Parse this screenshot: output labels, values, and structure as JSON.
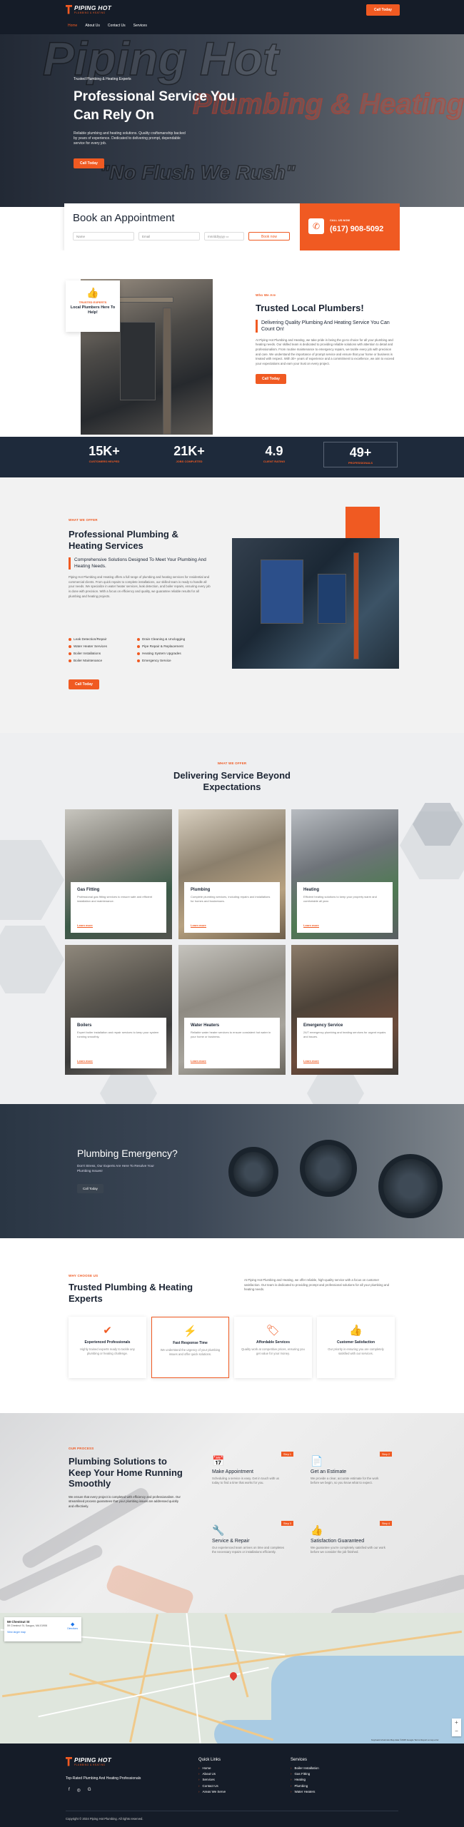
{
  "nav": {
    "logo_title": "PIPING HOT",
    "logo_sub": "PLUMBING & HEATING",
    "links": [
      "Home",
      "About Us",
      "Contact Us",
      "Services"
    ],
    "cta": "Call Today"
  },
  "hero": {
    "bg_word1": "Piping Hot",
    "bg_word2": "Plumbing & Heating",
    "bg_word3": "\"No Flush We Rush\"",
    "tag": "Trusted Plumbing & Heating Experts",
    "title": "Professional Service You Can Rely On",
    "desc": "Reliable plumbing and heating solutions. Quality craftsmanship backed by years of experience. Dedicated to delivering prompt, dependable service for every job.",
    "cta": "Call Today"
  },
  "appointment": {
    "title": "Book an Appointment",
    "name_placeholder": "Name",
    "email_placeholder": "Email",
    "date_placeholder": "mm/dd/yyyy",
    "book_label": "Book now",
    "call_label": "CALL US NOW",
    "phone": "(617) 908-5092"
  },
  "about": {
    "badge_eyebrow": "TRUSTED EXPERTS",
    "badge_title": "Local Plumbers Here To Help!",
    "eyebrow": "Who We Are",
    "title": "Trusted Local Plumbers!",
    "subtitle": "Delivering Quality Plumbing And Heating Service You Can Count On!",
    "desc": "At Piping Hot Plumbing and Heating, we take pride in being the go-to choice for all your plumbing and heating needs. Our skilled team is dedicated to providing reliable solutions with attention to detail and professionalism. From routine maintenance to emergency repairs, we tackle every job with precision and care. We understand the importance of prompt service and ensure that your home or business is treated with respect. With 30+ years of experience and a commitment to excellence, we aim to exceed your expectations and earn your trust on every project.",
    "cta": "Call Today"
  },
  "stats": [
    {
      "value": "15K+",
      "label": "CUSTOMERS HELPED"
    },
    {
      "value": "21K+",
      "label": "JOBS COMPLETED"
    },
    {
      "value": "4.9",
      "label": "CLIENT RATING"
    },
    {
      "value": "49+",
      "label": "PROFESSIONALS"
    }
  ],
  "services_intro": {
    "eyebrow": "WHAT WE OFFER",
    "title": "Professional Plumbing & Heating Services",
    "subtitle": "Comprehensive Solutions Designed To Meet Your Plumbing And Heating Needs.",
    "desc": "Piping Hot Plumbing and Heating offers a full range of plumbing and heating services for residential and commercial clients. From quick repairs to complete installations, our skilled team is ready to handle all your needs. We specialize in water heater services, leak detection, and boiler repairs, ensuring every job is done with precision. With a focus on efficiency and quality, we guarantee reliable results for all plumbing and heating projects.",
    "list": [
      "Leak Detection/Repair",
      "Drain Cleaning & Unclogging",
      "Water Heater Services",
      "Pipe Repair & Replacement",
      "Boiler Installations",
      "Heating System Upgrades",
      "Boiler Maintenance",
      "Emergency Service"
    ],
    "cta": "Call Today"
  },
  "beyond": {
    "eyebrow": "WHAT WE OFFER",
    "title": "Delivering Service Beyond Expectations",
    "learn_more": "Learn more",
    "cards": [
      {
        "title": "Gas Fitting",
        "desc": "Professional gas fitting services to ensure safe and efficient installation and maintenance."
      },
      {
        "title": "Plumbing",
        "desc": "Complete plumbing services, including repairs and installations for homes and businesses."
      },
      {
        "title": "Heating",
        "desc": "Efficient heating solutions to keep your property warm and comfortable all year."
      },
      {
        "title": "Boilers",
        "desc": "Expert boiler installation and repair services to keep your system running smoothly."
      },
      {
        "title": "Water Heaters",
        "desc": "Reliable water heater services to ensure consistent hot water in your home or business."
      },
      {
        "title": "Emergency Service",
        "desc": "24/7 emergency plumbing and heating services for urgent repairs and issues."
      }
    ]
  },
  "emergency": {
    "title": "Plumbing Emergency?",
    "desc": "Don't Stress, Our Experts Are Here To Resolve Your Plumbing Issues!",
    "cta": "Call Today"
  },
  "why": {
    "eyebrow": "WHY CHOOSE US",
    "title": "Trusted Plumbing & Heating Experts",
    "desc": "At Piping Hot Plumbing and Heating, we offer reliable, high-quality service with a focus on customer satisfaction. Our team is dedicated to providing prompt and professional solutions for all your plumbing and heating needs.",
    "cards": [
      {
        "title": "Experienced Professionals",
        "desc": "Highly trained experts ready to tackle any plumbing or heating challenge."
      },
      {
        "title": "Fast Response Time",
        "desc": "We understand the urgency of your plumbing issues and offer quick solutions."
      },
      {
        "title": "Affordable Services",
        "desc": "Quality work at competitive prices, ensuring you get value for your money."
      },
      {
        "title": "Customer Satisfaction",
        "desc": "Our priority is ensuring you are completely satisfied with our services."
      }
    ]
  },
  "process": {
    "eyebrow": "OUR PROCESS",
    "title": "Plumbing Solutions to Keep Your Home Running Smoothly",
    "desc": "We ensure that every project is completed with efficiency and professionalism. Our streamlined process guarantees that your plumbing issues are addressed quickly and effectively.",
    "steps": [
      {
        "tag": "Step 1",
        "title": "Make Appointment",
        "desc": "Scheduling a service is easy. Get in touch with us today to find a time that works for you."
      },
      {
        "tag": "Step 2",
        "title": "Get an Estimate",
        "desc": "We provide a clear, accurate estimate for the work before we begin, so you know what to expect."
      },
      {
        "tag": "Step 3",
        "title": "Service & Repair",
        "desc": "Our experienced team arrives on time and completes the necessary repairs or installations efficiently."
      },
      {
        "tag": "Step 4",
        "title": "Satisfaction Guaranteed",
        "desc": "We guarantee you're completely satisfied with our work before we consider the job finished."
      }
    ]
  },
  "map": {
    "place": "59 Chestnut St",
    "address": "59 Chestnut St, Saugus, MA 01906",
    "link": "View larger map",
    "directions": "Directions",
    "footer": "Keyboard shortcuts   Map data ©2025 Google   Terms   Report a map error"
  },
  "footer": {
    "tagline": "Top-Rated Plumbing And Heating Professionals",
    "quick_title": "Quick Links",
    "quick": [
      "Home",
      "About Us",
      "Services",
      "Contact Us",
      "Areas We Serve"
    ],
    "services_title": "Services",
    "services": [
      "Boiler Installation",
      "Gas Fitting",
      "Heating",
      "Plumbing",
      "Water Heaters"
    ],
    "copyright": "Copyright © 2024 Piping Hot Plumbing. All rights reserved."
  }
}
